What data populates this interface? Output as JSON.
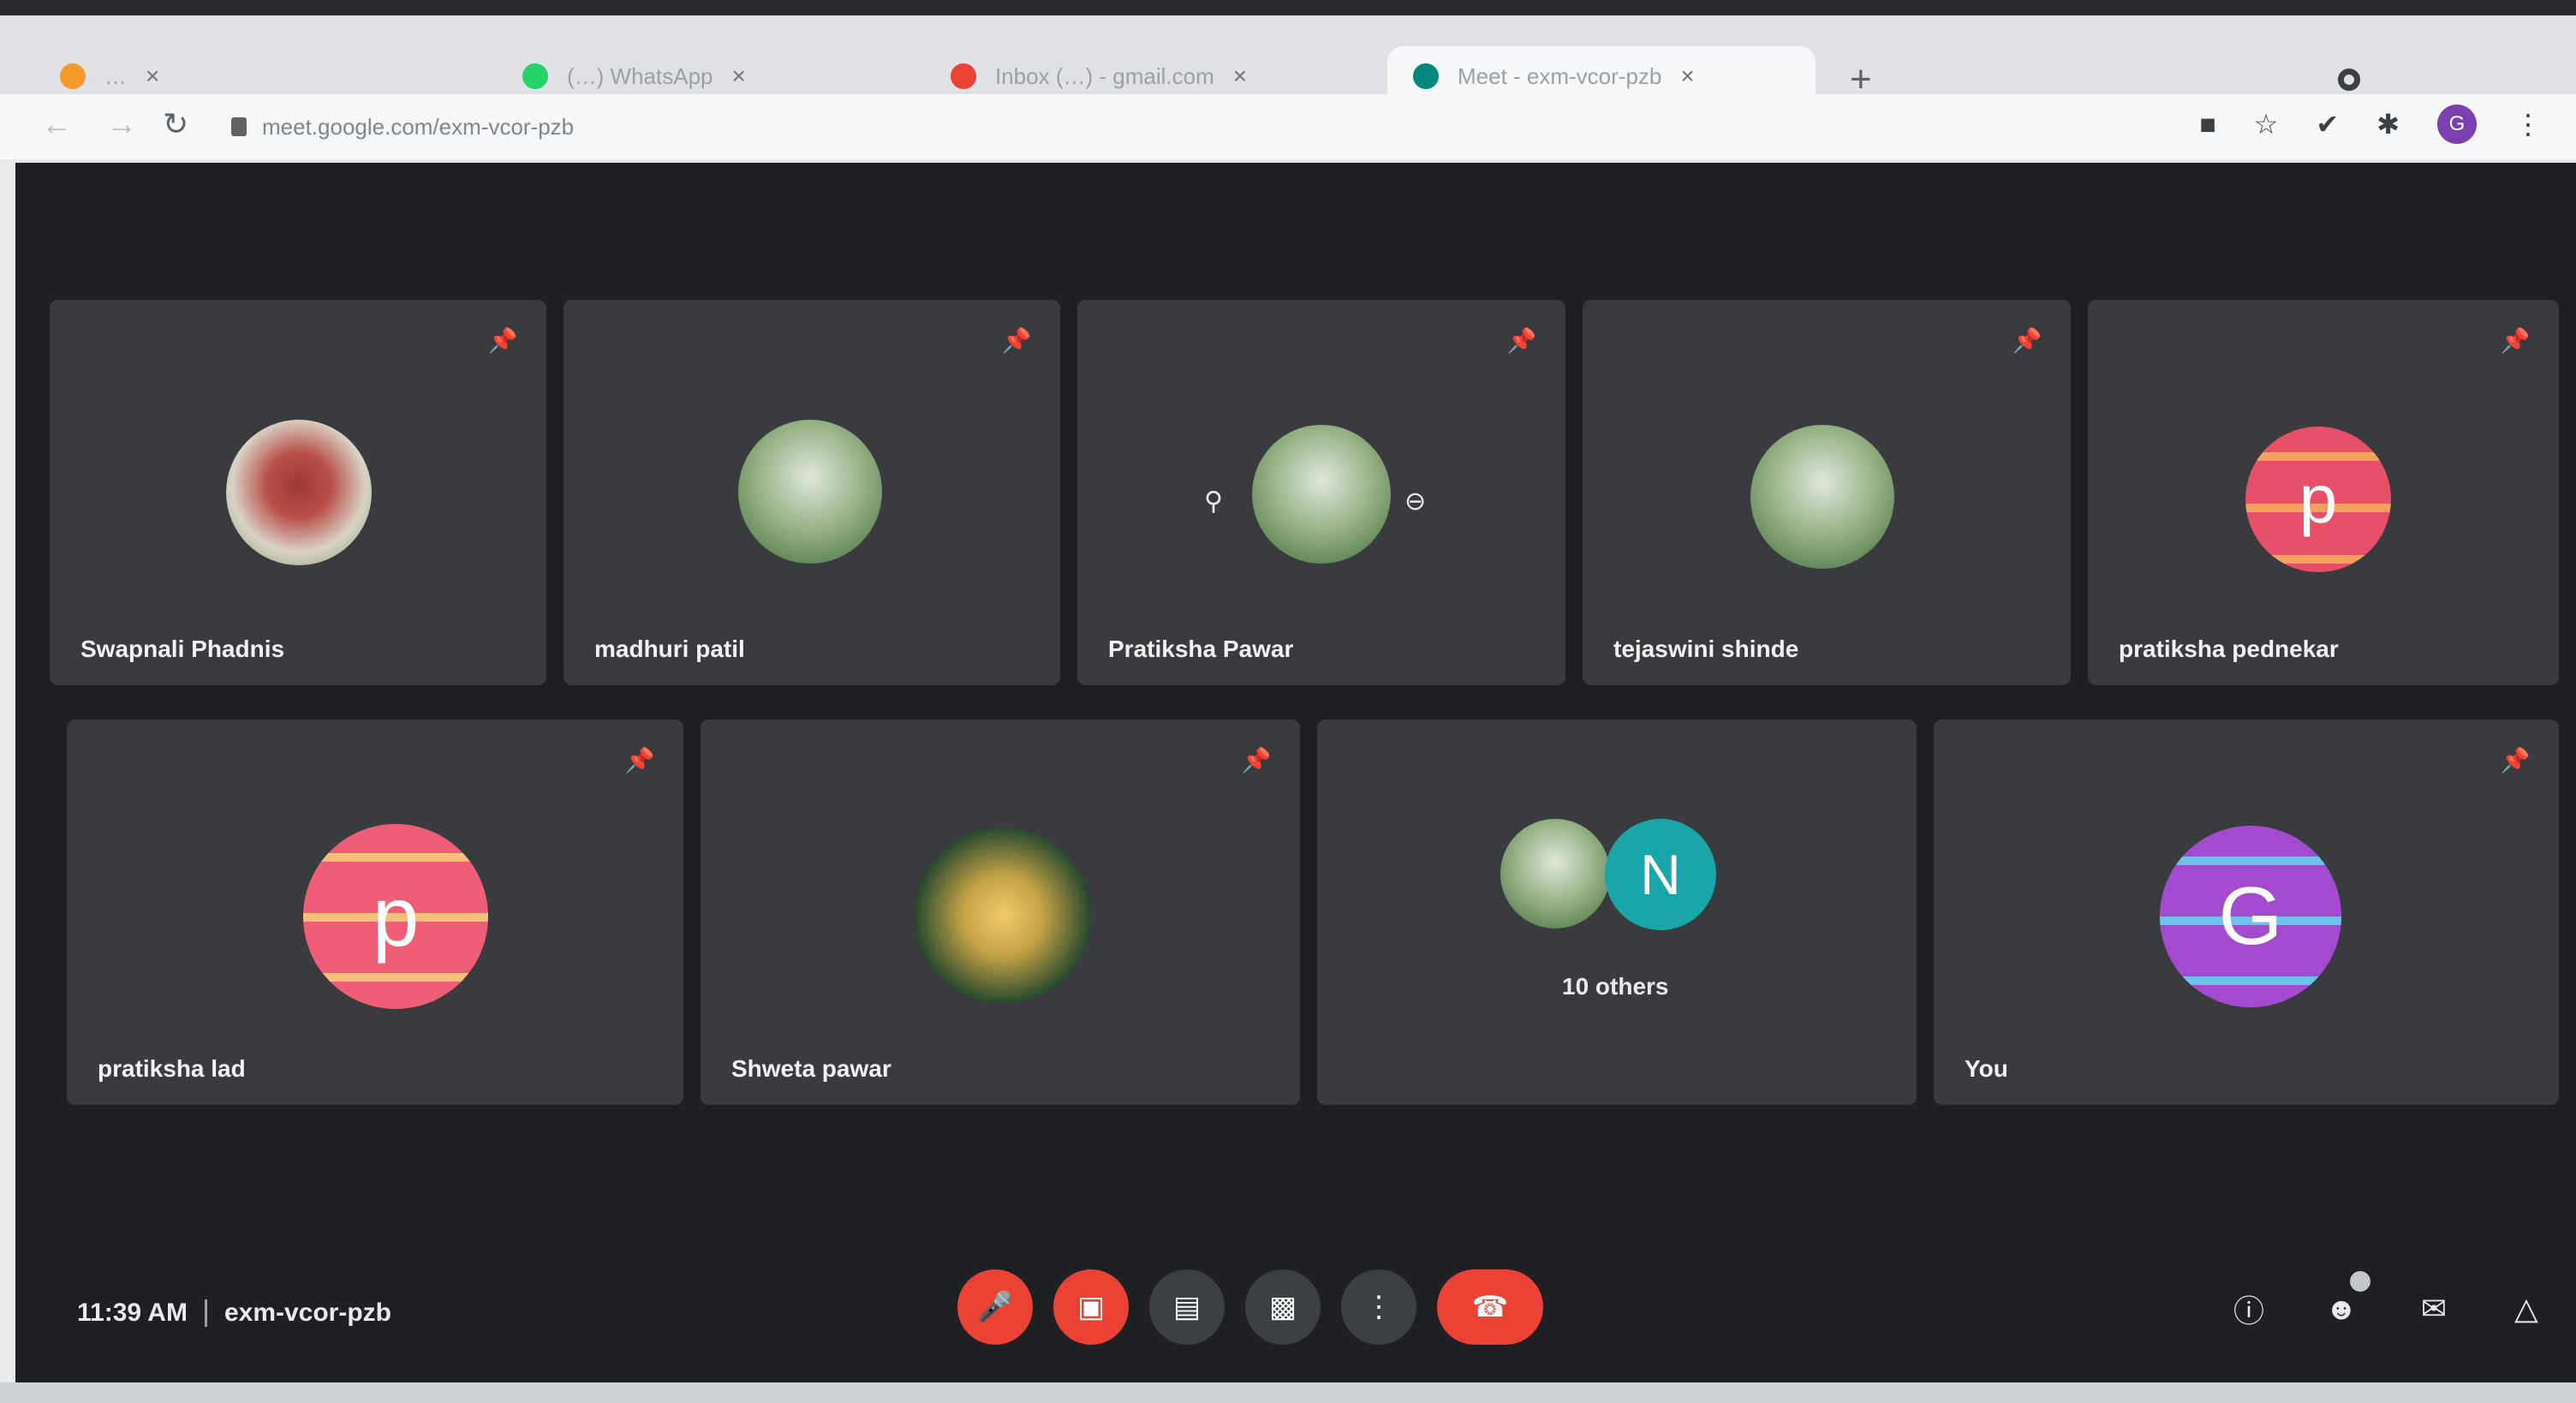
{
  "browser": {
    "tabs": [
      {
        "title": "…",
        "favicon_color": "#f59b2b",
        "close": "×"
      },
      {
        "title": "(…) WhatsApp",
        "favicon_color": "#25d366",
        "close": "×"
      },
      {
        "title": "Inbox (…) - gmail.com",
        "favicon_color": "#ea4335",
        "close": "×"
      },
      {
        "title": "Meet - exm-vcor-pzb",
        "favicon_color": "#00897b",
        "close": "×"
      }
    ],
    "new_tab": "+",
    "url": "meet.google.com/exm-vcor-pzb",
    "profile_initial": "G"
  },
  "participants": [
    {
      "name": "Swapnali Phadnis",
      "avatar_type": "photo",
      "style": "rose"
    },
    {
      "name": "madhuri patil",
      "avatar_type": "photo",
      "style": "person"
    },
    {
      "name": "Pratiksha Pawar",
      "avatar_type": "photo",
      "style": "person"
    },
    {
      "name": "tejaswini shinde",
      "avatar_type": "photo",
      "style": "person"
    },
    {
      "name": "pratiksha pednekar",
      "avatar_type": "letter",
      "letter": "p"
    },
    {
      "name": "pratiksha lad",
      "avatar_type": "letter",
      "letter": "p"
    },
    {
      "name": "Shweta pawar",
      "avatar_type": "photo",
      "style": "cake"
    },
    {
      "name": "10 others",
      "avatar_type": "group",
      "letter": "N"
    },
    {
      "name": "You",
      "avatar_type": "letter",
      "letter": "G"
    }
  ],
  "meeting": {
    "time": "11:39 AM",
    "code": "exm-vcor-pzb"
  },
  "controls": {
    "mic": "mic-off-icon",
    "camera": "camera-off-icon",
    "captions": "captions-icon",
    "present": "present-icon",
    "more": "more-vert-icon",
    "end_call": "end-call-icon"
  },
  "colors": {
    "tile_bg": "#3a3b3e",
    "meet_bg": "#1f2023",
    "red": "#ea4335"
  }
}
